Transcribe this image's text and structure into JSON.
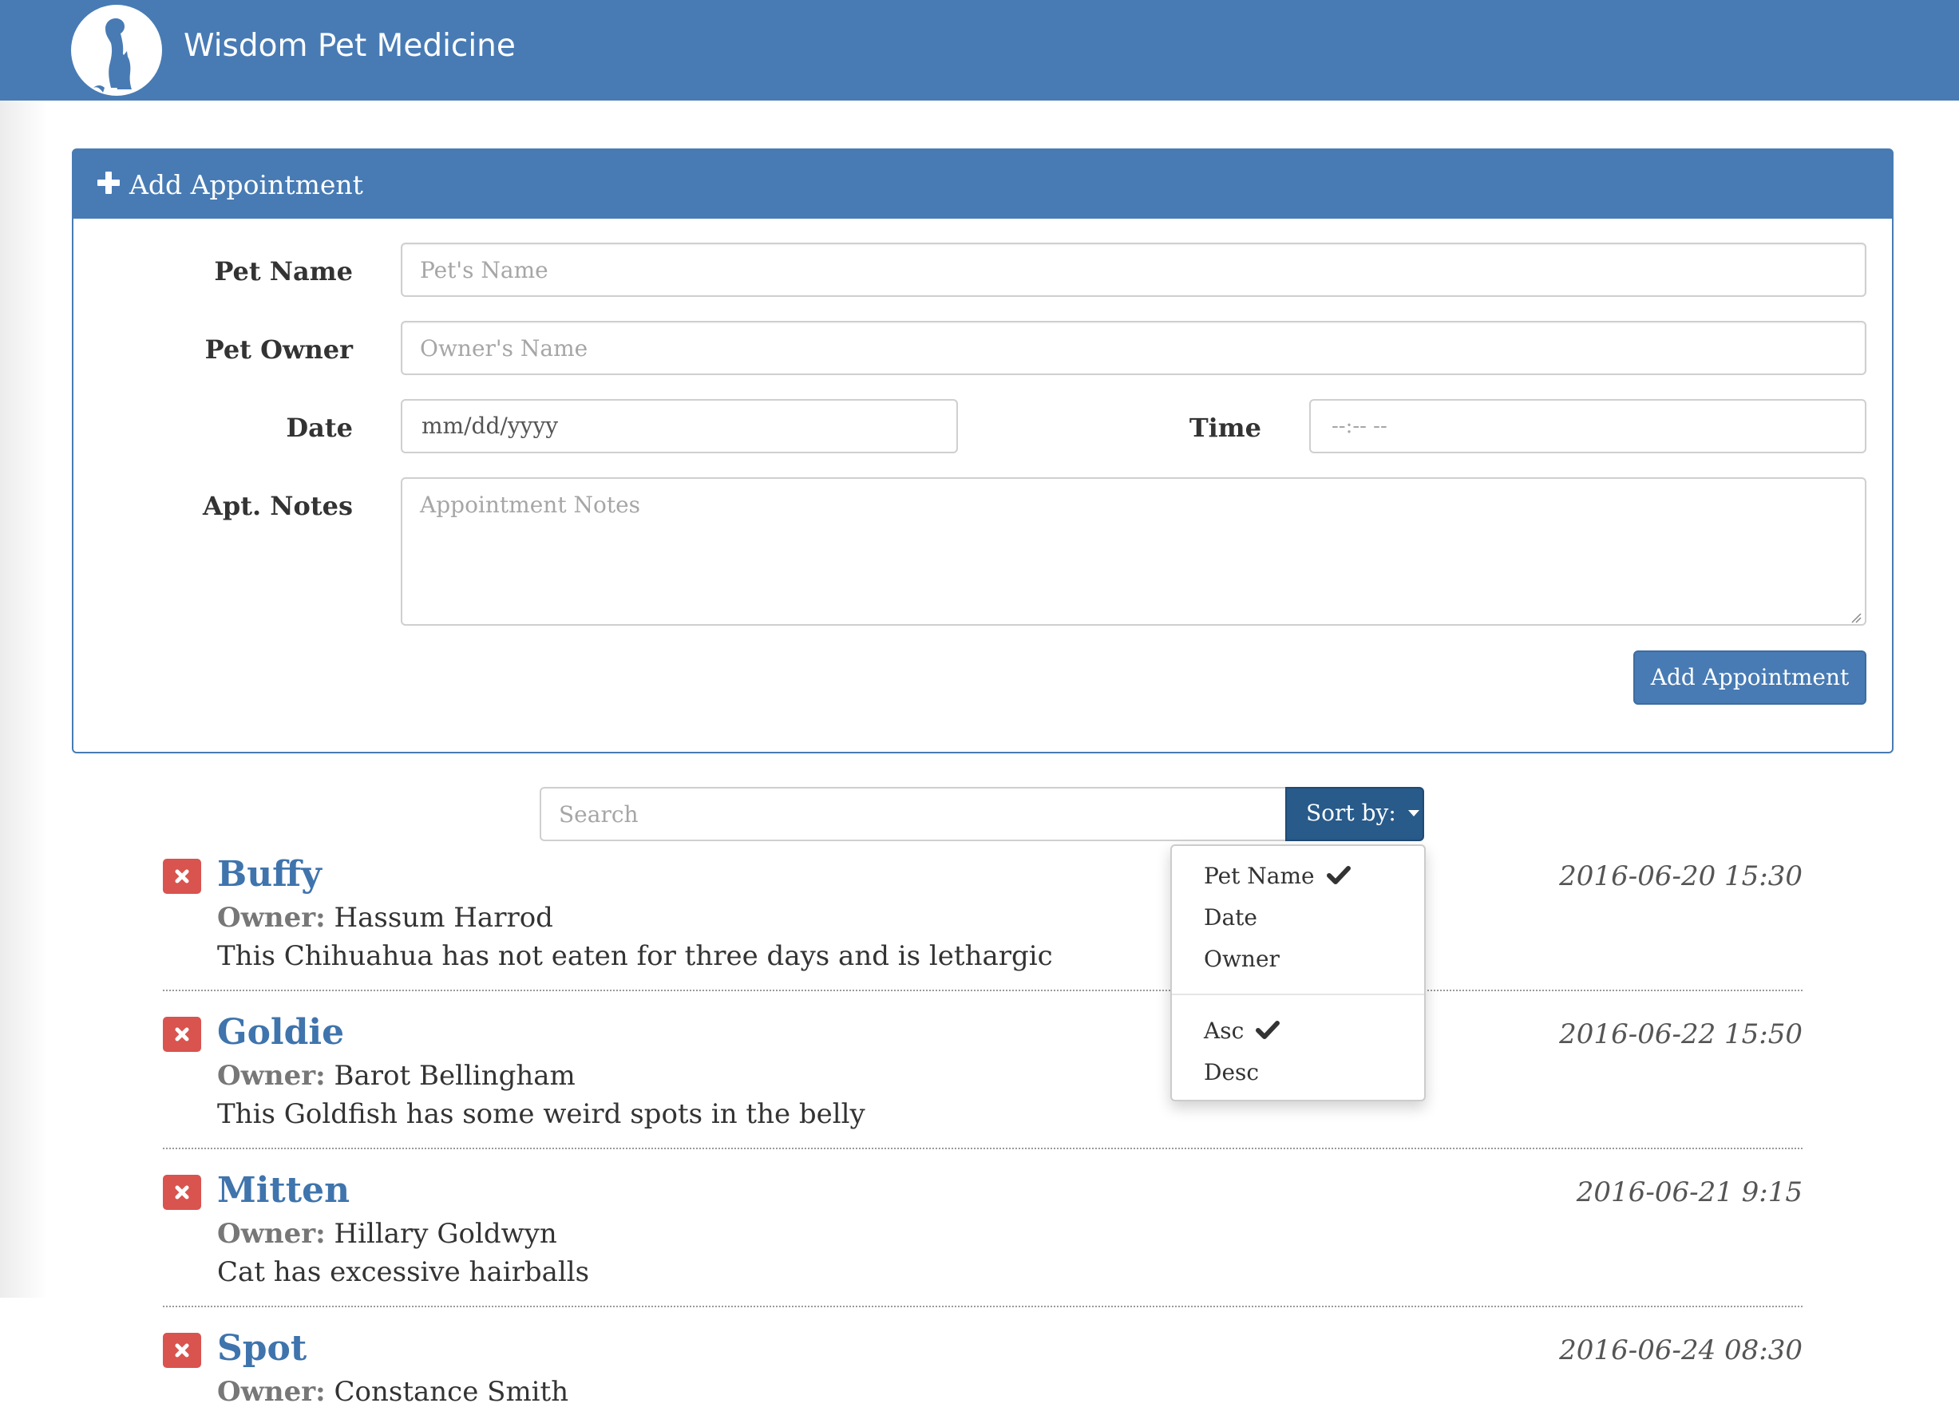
{
  "header": {
    "brand": "Wisdom Pet Medicine"
  },
  "add_panel": {
    "title": "Add Appointment",
    "fields": {
      "pet_name": {
        "label": "Pet Name",
        "placeholder": "Pet's Name",
        "value": ""
      },
      "pet_owner": {
        "label": "Pet Owner",
        "placeholder": "Owner's Name",
        "value": ""
      },
      "date": {
        "label": "Date",
        "display": "mm/dd/yyyy"
      },
      "time": {
        "label": "Time",
        "display": "--:-- --"
      },
      "notes": {
        "label": "Apt. Notes",
        "placeholder": "Appointment Notes",
        "value": ""
      }
    },
    "submit_label": "Add Appointment"
  },
  "search": {
    "placeholder": "Search",
    "value": ""
  },
  "sort": {
    "button_label": "Sort by:",
    "fields": [
      {
        "label": "Pet Name",
        "checked": true
      },
      {
        "label": "Date",
        "checked": false
      },
      {
        "label": "Owner",
        "checked": false
      }
    ],
    "orders": [
      {
        "label": "Asc",
        "checked": true
      },
      {
        "label": "Desc",
        "checked": false
      }
    ]
  },
  "appointments": [
    {
      "pet_name": "Buffy",
      "owner_label": "Owner:",
      "owner": "Hassum Harrod",
      "notes": "This Chihuahua has not eaten for three days and is lethargic",
      "date": "2016-06-20 15:30"
    },
    {
      "pet_name": "Goldie",
      "owner_label": "Owner:",
      "owner": "Barot Bellingham",
      "notes": "This Goldfish has some weird spots in the belly",
      "date": "2016-06-22 15:50"
    },
    {
      "pet_name": "Mitten",
      "owner_label": "Owner:",
      "owner": "Hillary Goldwyn",
      "notes": "Cat has excessive hairballs",
      "date": "2016-06-21 9:15"
    },
    {
      "pet_name": "Spot",
      "owner_label": "Owner:",
      "owner": "Constance Smith",
      "notes": "",
      "date": "2016-06-24 08:30"
    }
  ],
  "colors": {
    "brand_blue": "#487bb4",
    "sort_button": "#285a8a",
    "delete_red": "#d9534f",
    "pet_name_link": "#3f74ad"
  },
  "icons": [
    "logo-dog-cat-icon",
    "plus-icon",
    "delete-icon",
    "caret-down-icon",
    "check-icon",
    "resize-grip-icon"
  ]
}
